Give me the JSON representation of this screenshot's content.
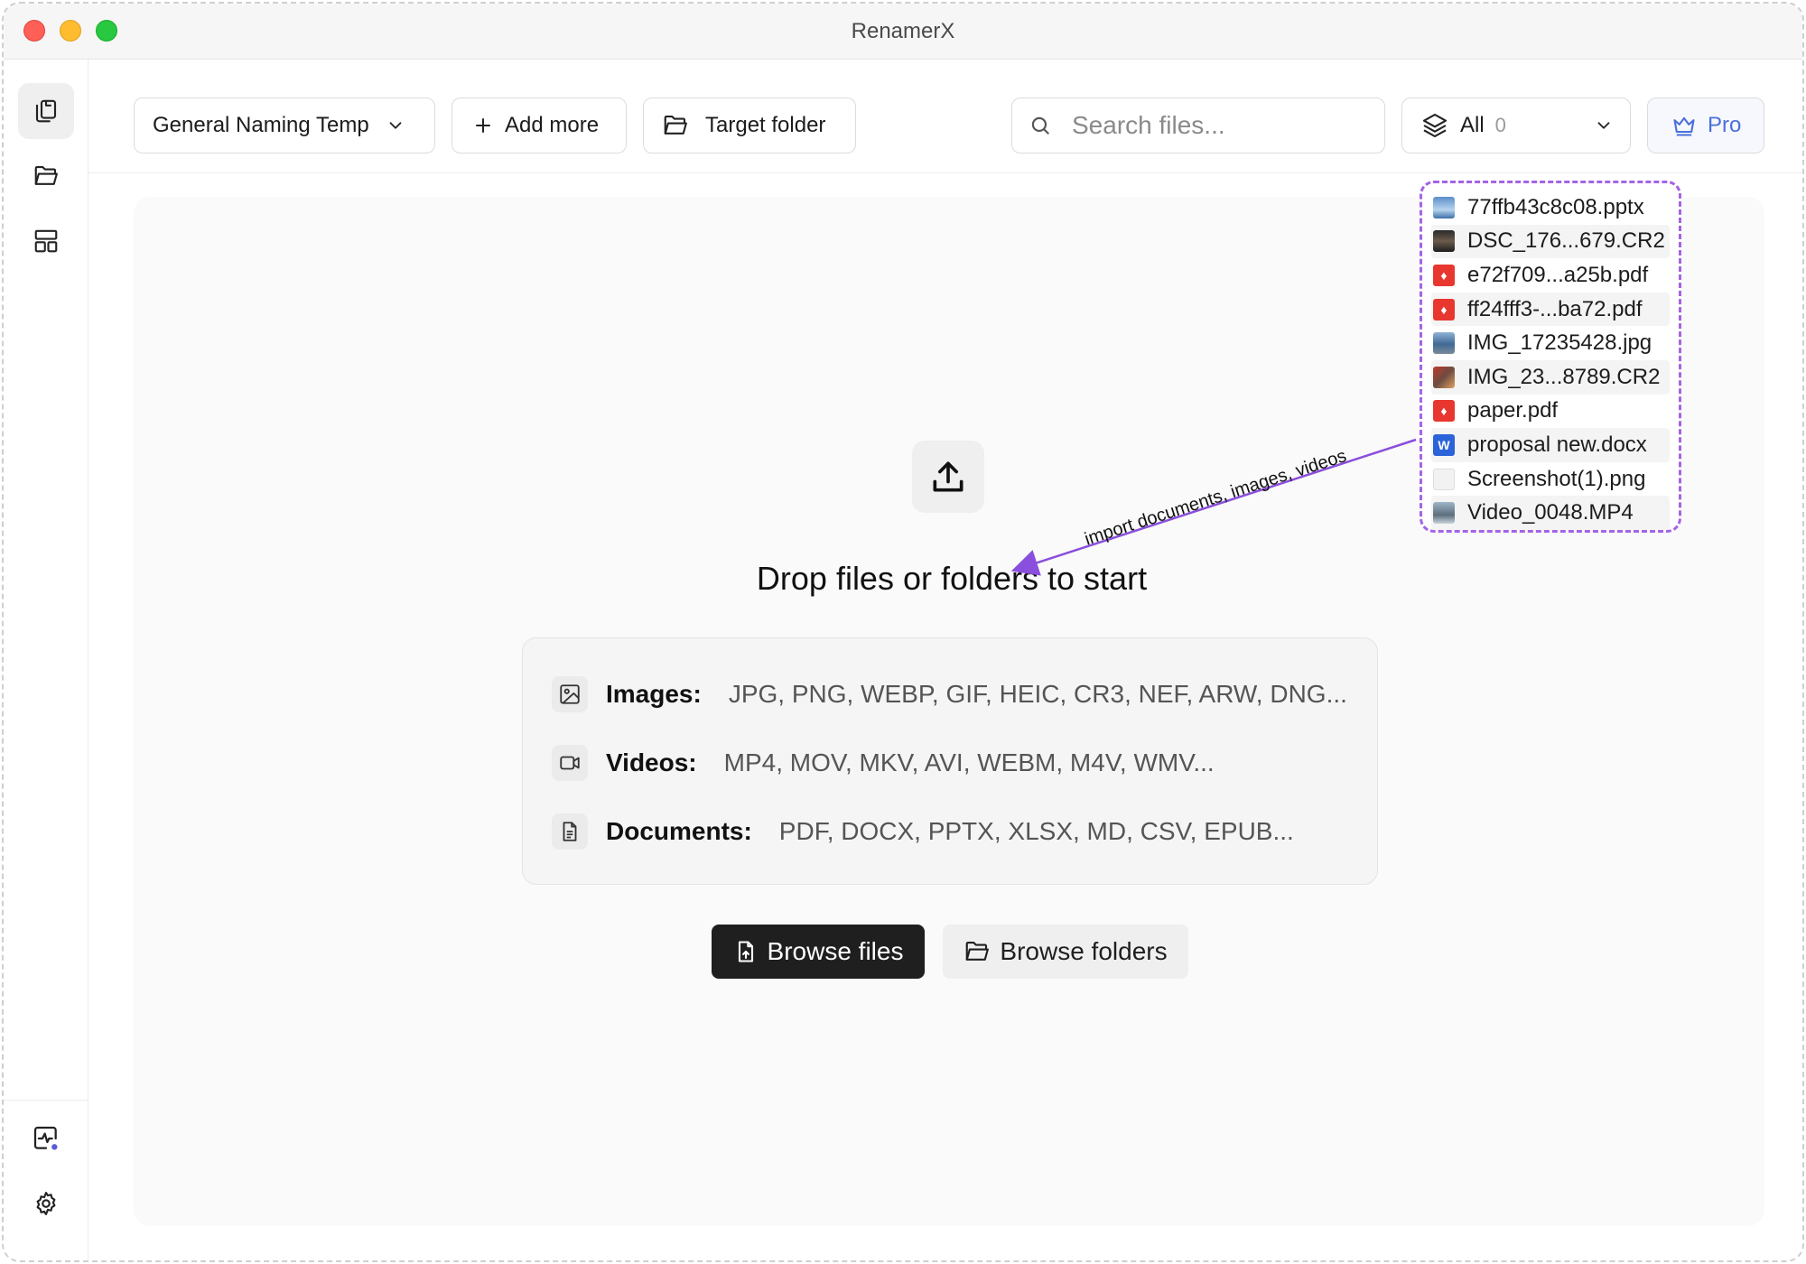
{
  "window": {
    "title": "RenamerX"
  },
  "toolbar": {
    "template_label": "General Naming Temp",
    "add_more_label": "Add more",
    "target_folder_label": "Target folder",
    "search_placeholder": "Search files...",
    "filter_label": "All",
    "filter_count": "0",
    "pro_label": "Pro"
  },
  "main": {
    "drop_title": "Drop files or folders to start",
    "types": [
      {
        "label": "Images:",
        "values": "JPG, PNG, WEBP, GIF, HEIC, CR3, NEF, ARW, DNG..."
      },
      {
        "label": "Videos:",
        "values": "MP4, MOV, MKV, AVI, WEBM, M4V, WMV..."
      },
      {
        "label": "Documents:",
        "values": "PDF, DOCX, PPTX, XLSX, MD, CSV, EPUB..."
      }
    ],
    "browse_files_label": "Browse files",
    "browse_folders_label": "Browse folders"
  },
  "import_files": [
    {
      "name": "77ffb43c8c08.pptx",
      "icon": "slide-thumbnail-icon"
    },
    {
      "name": "DSC_176...679.CR2",
      "icon": "camera-raw-thumbnail-icon"
    },
    {
      "name": "e72f709...a25b.pdf",
      "icon": "pdf-icon"
    },
    {
      "name": "ff24fff3-...ba72.pdf",
      "icon": "pdf-icon"
    },
    {
      "name": "IMG_17235428.jpg",
      "icon": "photo-thumbnail-icon"
    },
    {
      "name": "IMG_23...8789.CR2",
      "icon": "camera-raw-thumbnail-icon"
    },
    {
      "name": "paper.pdf",
      "icon": "pdf-icon"
    },
    {
      "name": "proposal new.docx",
      "icon": "word-doc-icon"
    },
    {
      "name": "Screenshot(1).png",
      "icon": "screenshot-thumbnail-icon"
    },
    {
      "name": "Video_0048.MP4",
      "icon": "video-thumbnail-icon"
    }
  ],
  "annotation": {
    "text": "import documents, images, videos"
  },
  "colors": {
    "accent_purple": "#a463e6",
    "pro_blue": "#4a6fdc",
    "pdf_red": "#e8372f",
    "word_blue": "#2b63d9",
    "status_dot": "#5b5bd6"
  }
}
